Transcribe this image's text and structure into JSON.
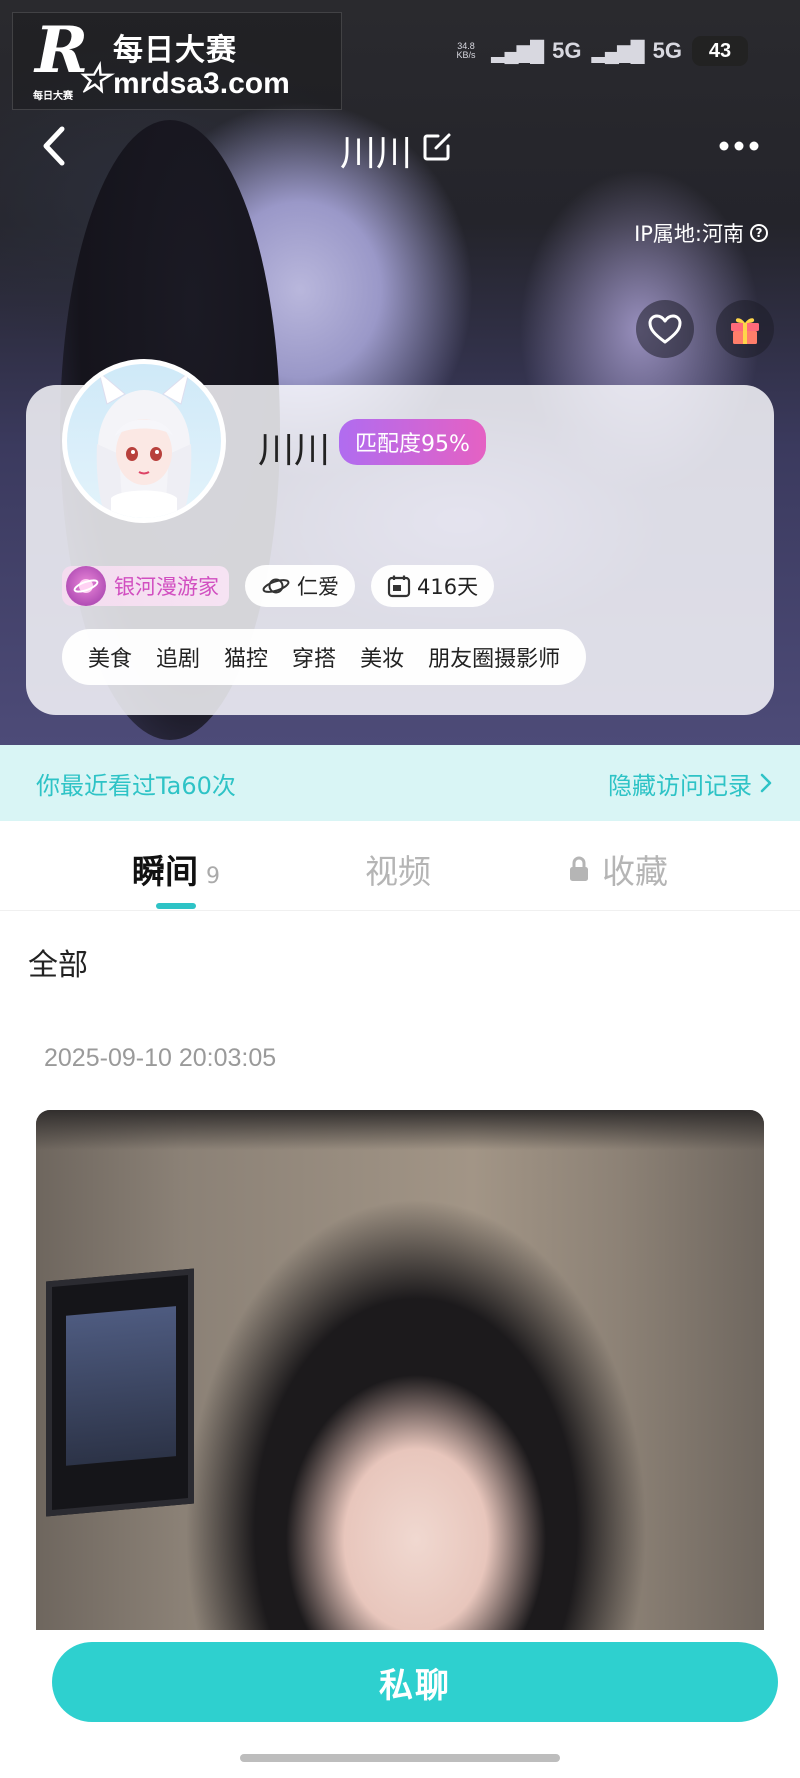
{
  "watermark": {
    "logo_letter": "R",
    "logo_star": "☆",
    "logo_small": "每日大赛",
    "title": "每日大赛",
    "url": "mrdsa3.com"
  },
  "status_bar": {
    "net_speed": "34.8 KB/s",
    "signal1": "5G",
    "signal2": "5G",
    "battery": "43"
  },
  "nav": {
    "title": "川川"
  },
  "hero": {
    "ip_location": "IP属地:河南",
    "help_glyph": "?"
  },
  "profile": {
    "nickname": "川川",
    "match": "匹配度95%",
    "level": "银河漫游家",
    "planet_chip": "仁爱",
    "days_chip": "416天",
    "tags": [
      "美食",
      "追剧",
      "猫控",
      "穿搭",
      "美妆",
      "朋友圈摄影师"
    ]
  },
  "visit": {
    "left_text": "你最近看过Ta60次",
    "right_text": "隐藏访问记录"
  },
  "tabs": {
    "moments_label": "瞬间",
    "moments_count": "9",
    "video_label": "视频",
    "favorites_label": "收藏"
  },
  "feed": {
    "section_title": "全部",
    "post_time": "2025-09-10 20:03:05"
  },
  "actions": {
    "chat_label": "私聊"
  },
  "colors": {
    "accent": "#2ED0CF",
    "match_gradient_start": "#B06CF0",
    "match_gradient_end": "#E561C3",
    "level_text": "#D14EC0"
  }
}
